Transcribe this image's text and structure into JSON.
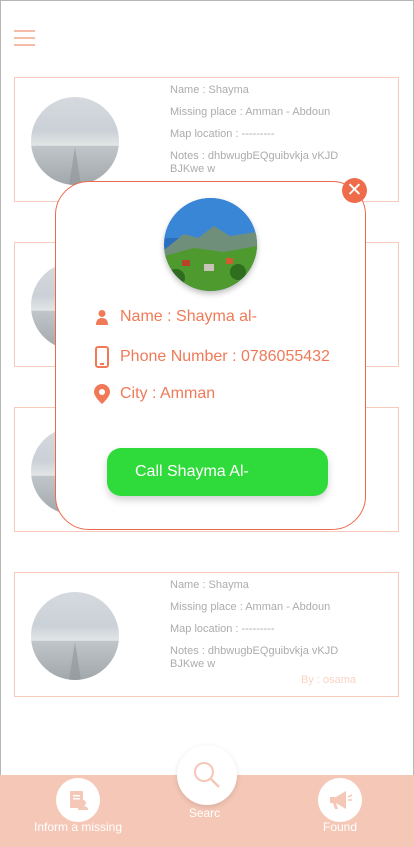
{
  "cards": [
    {
      "name": "Name : Shayma",
      "missing_place": "Missing place : Amman - Abdoun",
      "map_location": "Map location : ---------",
      "notes": "Notes : dhbwugbEQguibvkja vKJD BJKwe w",
      "by": ""
    },
    {
      "name": "Name : Shayma",
      "missing_place": "Missing place : Amman - Abdoun",
      "map_location": "Map location : ---------",
      "notes": "Notes : dhbwugbEQguibvkja vKJD BJKwe w",
      "by": "By : osama"
    }
  ],
  "modal": {
    "name": "Name : Shayma al-",
    "phone": "Phone Number : 0786055432",
    "city": "City : Amman",
    "call_label": "Call Shayma Al-",
    "close_glyph": "✕"
  },
  "bottom_nav": {
    "inform_label": "Inform a missing",
    "search_label": "Searc",
    "found_label": "Found"
  },
  "colors": {
    "accent": "#ef6c4b",
    "call_button": "#2fdb3a",
    "bottom_bar": "#f5c7b6"
  },
  "icons": [
    "menu-icon",
    "close-icon",
    "person-icon",
    "phone-icon",
    "location-pin-icon",
    "search-icon",
    "document-icon",
    "megaphone-icon"
  ]
}
